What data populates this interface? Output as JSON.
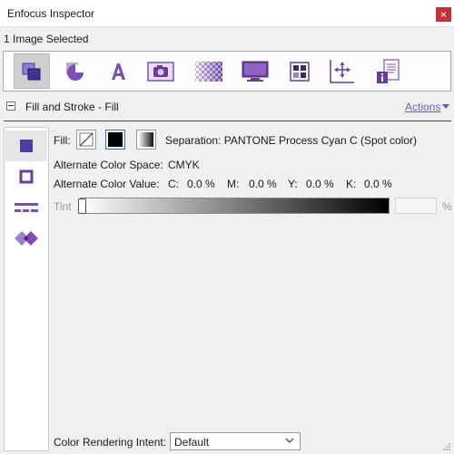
{
  "window": {
    "title": "Enfocus Inspector",
    "close_label": "×"
  },
  "selection_info": "1 Image Selected",
  "toolbar": {
    "tools": [
      {
        "icon": "fill-stroke-icon",
        "active": true
      },
      {
        "icon": "pie-object-icon",
        "active": false
      },
      {
        "icon": "text-a-icon",
        "active": false
      },
      {
        "icon": "camera-icon",
        "active": false
      },
      {
        "icon": "transparency-checker-icon",
        "active": false
      },
      {
        "icon": "monitor-icon",
        "active": false
      },
      {
        "icon": "layout-grid-icon",
        "active": false
      },
      {
        "icon": "position-move-icon",
        "active": false
      },
      {
        "icon": "document-info-icon",
        "active": false
      }
    ]
  },
  "section": {
    "title": "Fill and Stroke - Fill",
    "actions_label": "Actions"
  },
  "side_tabs": [
    {
      "icon": "fill-square-icon",
      "active": true
    },
    {
      "icon": "stroke-square-icon",
      "active": false
    },
    {
      "icon": "dash-lines-icon",
      "active": false
    },
    {
      "icon": "overprint-diamonds-icon",
      "active": false
    }
  ],
  "fill": {
    "label": "Fill:",
    "separation": "Separation: PANTONE Process Cyan C (Spot color)",
    "alt_space_label": "Alternate Color Space:",
    "alt_space_value": "CMYK",
    "alt_value_label": "Alternate Color Value:",
    "c_label": "C:",
    "c_value": "0.0 %",
    "m_label": "M:",
    "m_value": "0.0 %",
    "y_label": "Y:",
    "y_value": "0.0 %",
    "k_label": "K:",
    "k_value": "0.0 %",
    "tint_label": "Tint",
    "tint_unit": "%",
    "tint_input_value": ""
  },
  "rendering": {
    "label": "Color Rendering Intent:",
    "value": "Default"
  },
  "colors": {
    "accent": "#6b5bb8",
    "icon_purple": "#6a3d9a",
    "close_red": "#c6303a"
  }
}
